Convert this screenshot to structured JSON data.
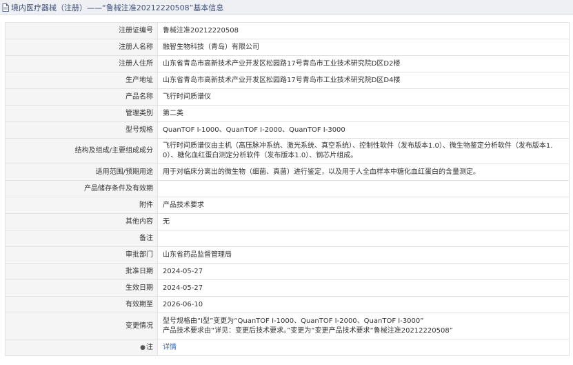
{
  "header": {
    "breadcrumb_title": "境内医疗器械（注册）——“鲁械注准20212220508”基本信息"
  },
  "rows": [
    {
      "label": "注册证编号",
      "value": "鲁械注准20212220508"
    },
    {
      "label": "注册人名称",
      "value": "融智生物科技（青岛）有限公司"
    },
    {
      "label": "注册人住所",
      "value": "山东省青岛市高新技术产业开发区松园路17号青岛市工业技术研究院D区D2楼"
    },
    {
      "label": "生产地址",
      "value": "山东省青岛市高新技术产业开发区松园路17号青岛市工业技术研究院D区D4楼"
    },
    {
      "label": "产品名称",
      "value": "飞行时间质谱仪"
    },
    {
      "label": "管理类别",
      "value": "第二类"
    },
    {
      "label": "型号规格",
      "value": "QuanTOF I-1000、QuanTOF I-2000、QuanTOF I-3000"
    },
    {
      "label": "结构及组成/主要组成成分",
      "lines": [
        "飞行时间质谱仪由主机（高压脉冲系统、激光系统、真空系统）、控制性软件（发布版本1.0）、微生物鉴定分析软件（发布版本1.",
        "0）、糖化血红蛋白测定分析软件（发布版本1.0）、钢芯片组成。"
      ]
    },
    {
      "label": "适用范围/预期用途",
      "value": "用于对临床分离出的微生物（细菌、真菌）进行鉴定，以及用于人全血样本中糖化血红蛋白的含量测定。"
    },
    {
      "label": "产品储存条件及有效期",
      "value": ""
    },
    {
      "label": "附件",
      "value": "产品技术要求"
    },
    {
      "label": "其他内容",
      "value": "无"
    },
    {
      "label": "备注",
      "value": ""
    },
    {
      "label": "审批部门",
      "value": "山东省药品监督管理局"
    },
    {
      "label": "批准日期",
      "value": "2024-05-27"
    },
    {
      "label": "生效日期",
      "value": "2024-05-27"
    },
    {
      "label": "有效期至",
      "value": "2026-06-10"
    },
    {
      "label": "变更情况",
      "lines": [
        "型号规格由“I型”变更为“QuanTOF I-1000、QuanTOF I-2000、QuanTOF I-3000”",
        "产品技术要求由“详见：变更后技术要求。”变更为“变更产品技术要求“鲁械注准20212220508”"
      ]
    },
    {
      "label": "注",
      "value": "详情"
    }
  ],
  "colors": {
    "title_text": "#3d4f77",
    "title_background": "#eef0f4",
    "label_background": "#f5f5f5",
    "border": "#e2e2e2",
    "link": "#3a6ab5"
  },
  "icons": {
    "title": "document-icon",
    "note": "pin-icon"
  }
}
